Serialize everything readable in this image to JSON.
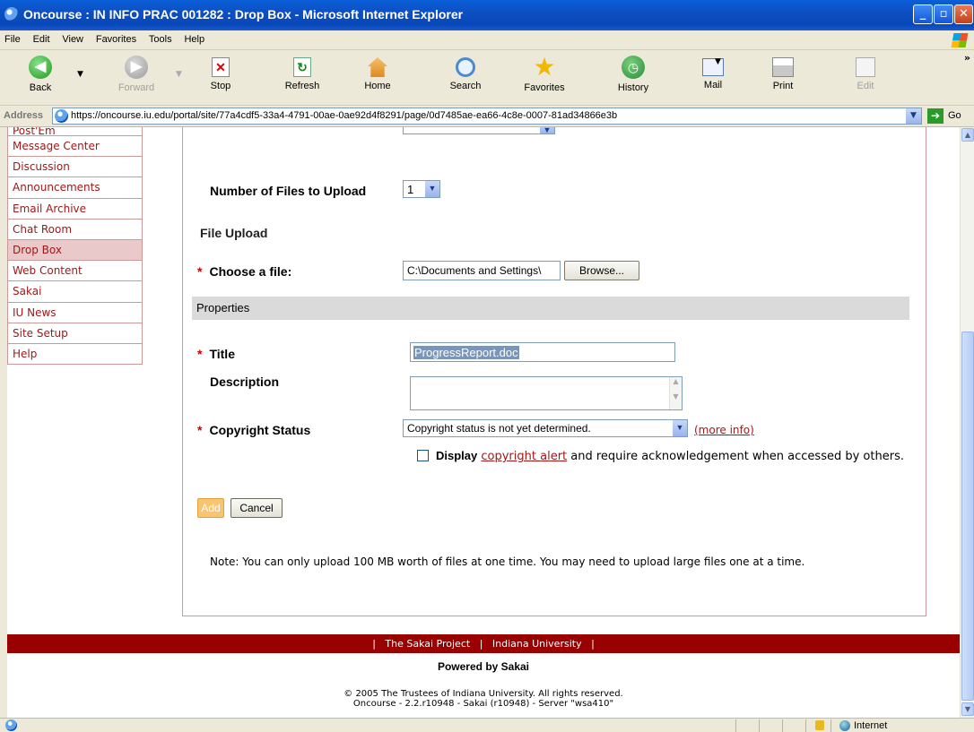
{
  "window": {
    "title": "Oncourse : IN INFO PRAC 001282 : Drop Box - Microsoft Internet Explorer"
  },
  "menu": [
    "File",
    "Edit",
    "View",
    "Favorites",
    "Tools",
    "Help"
  ],
  "toolbar": {
    "back": "Back",
    "forward": "Forward",
    "stop": "Stop",
    "refresh": "Refresh",
    "home": "Home",
    "search": "Search",
    "favorites": "Favorites",
    "history": "History",
    "mail": "Mail",
    "print": "Print",
    "edit": "Edit"
  },
  "address": {
    "label": "Address",
    "url": "https://oncourse.iu.edu/portal/site/77a4cdf5-33a4-4791-00ae-0ae92d4f8291/page/0d7485ae-ea66-4c8e-0007-81ad34866e3b",
    "go": "Go"
  },
  "nav": {
    "items": [
      "Post'Em",
      "Message Center",
      "Discussion",
      "Announcements",
      "Email Archive",
      "Chat Room",
      "Drop Box",
      "Web Content",
      "Sakai",
      "IU News",
      "Site Setup",
      "Help"
    ],
    "active": "Drop Box"
  },
  "form": {
    "num_files_label": "Number of Files to Upload",
    "num_files_value": "1",
    "file_upload_heading": "File Upload",
    "choose_file_label": "Choose a file:",
    "choose_file_value": "C:\\Documents and Settings\\",
    "browse": "Browse...",
    "properties_heading": "Properties",
    "title_label": "Title",
    "title_value": "ProgressReport.doc",
    "description_label": "Description",
    "copyright_label": "Copyright Status",
    "copyright_value": "Copyright status is not yet determined.",
    "more_info": "(more info)",
    "display_alert_prefix": "Display",
    "copyright_alert_link": "copyright alert",
    "display_alert_suffix": "and require acknowledgement when accessed by others.",
    "add": "Add",
    "cancel": "Cancel",
    "note": "Note: You can only upload 100 MB worth of files at one time. You may need to upload large files one at a time."
  },
  "footer": {
    "links": [
      "The Sakai Project",
      "Indiana University"
    ],
    "powered": "Powered by Sakai",
    "copyright": "© 2005 The Trustees of Indiana University. All rights reserved.",
    "version": "Oncourse - 2.2.r10948 - Sakai (r10948) - Server \"wsa410\""
  },
  "status": {
    "zone": "Internet"
  },
  "colors": {
    "accent": "#990000",
    "link": "#a01818",
    "nav_active": "#e9c9c9"
  }
}
